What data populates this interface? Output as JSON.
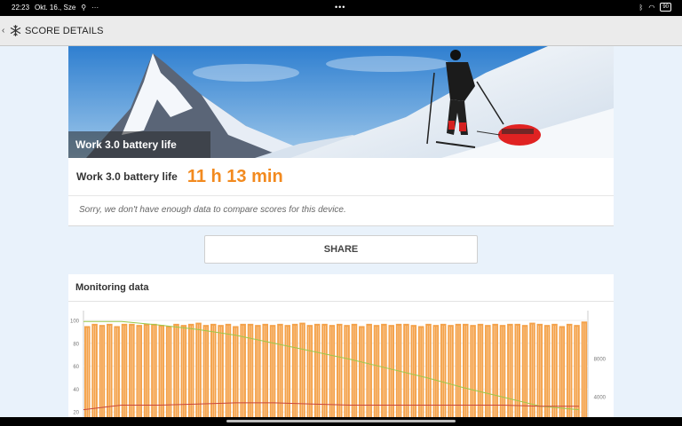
{
  "status_bar": {
    "time": "22:23",
    "date": "Okt. 16., Sze",
    "center": "•••",
    "battery": "90"
  },
  "app_bar": {
    "title": "SCORE DETAILS",
    "icons": [
      "back-arrow-icon",
      "snowflake-icon"
    ]
  },
  "hero": {
    "caption": "Work 3.0 battery life"
  },
  "result": {
    "label": "Work 3.0 battery life",
    "value": "11 h 13 min",
    "note": "Sorry, we don't have enough data to compare scores for this device."
  },
  "share_label": "SHARE",
  "monitoring": {
    "title": "Monitoring data"
  },
  "colors": {
    "accent": "#f28a1f",
    "bar": "#f4a24a",
    "battery_line": "#9bc94a",
    "temp_line": "#c9463b"
  },
  "chart_data": {
    "type": "bar",
    "bar_count": 68,
    "values": [
      95,
      97,
      96,
      97,
      95,
      97,
      97,
      96,
      97,
      97,
      96,
      95,
      97,
      96,
      97,
      98,
      96,
      97,
      96,
      97,
      95,
      97,
      97,
      96,
      97,
      96,
      97,
      96,
      97,
      98,
      96,
      97,
      97,
      96,
      97,
      96,
      97,
      95,
      97,
      96,
      97,
      96,
      97,
      97,
      96,
      95,
      97,
      96,
      97,
      96,
      97,
      97,
      96,
      97,
      96,
      97,
      96,
      97,
      97,
      96,
      98,
      97,
      96,
      97,
      95,
      97,
      96,
      99
    ],
    "left_axis": {
      "ticks": [
        100,
        80,
        60,
        40,
        20
      ],
      "ylim": [
        0,
        100
      ]
    },
    "right_axis": {
      "ticks": [
        8000,
        4000
      ],
      "ylim": [
        0,
        12000
      ]
    },
    "series": [
      {
        "values": [
          99,
          99,
          96,
          92,
          87,
          80,
          73,
          66,
          58,
          50,
          41,
          33,
          25,
          22
        ]
      },
      {
        "values": [
          22,
          26,
          26,
          27,
          28,
          28,
          27,
          26,
          26,
          26,
          26,
          26,
          25,
          25
        ]
      }
    ]
  }
}
